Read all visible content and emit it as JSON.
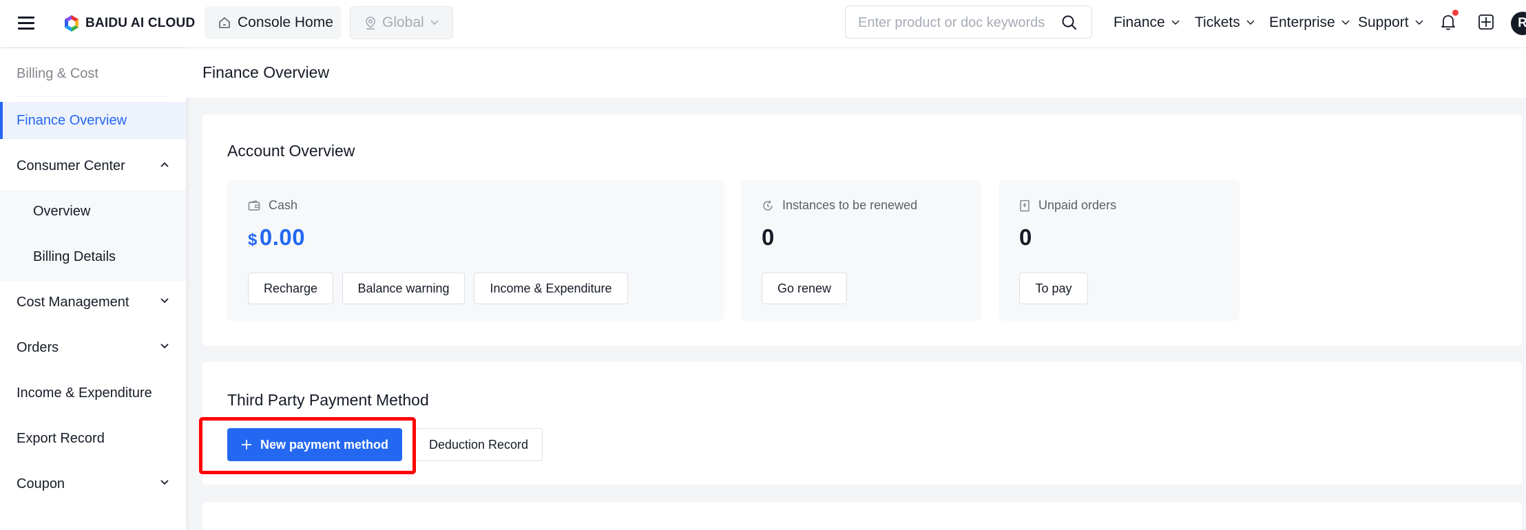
{
  "header": {
    "logo_text": "BAIDU AI CLOUD",
    "console_home": "Console Home",
    "region": "Global",
    "search_placeholder": "Enter product or doc keywords",
    "nav": [
      "Finance",
      "Tickets",
      "Enterprise",
      "Support"
    ],
    "avatar_letter": "R",
    "notification_dot_color": "#f33e3e"
  },
  "sidebar": {
    "title": "Billing & Cost",
    "items": [
      {
        "label": "Finance Overview",
        "active": true
      },
      {
        "label": "Consumer Center",
        "expanded": true
      },
      {
        "label": "Overview",
        "sub": true
      },
      {
        "label": "Billing Details",
        "sub": true
      },
      {
        "label": "Cost Management"
      },
      {
        "label": "Orders"
      },
      {
        "label": "Income & Expenditure"
      },
      {
        "label": "Export Record"
      },
      {
        "label": "Coupon"
      }
    ]
  },
  "main": {
    "page_title": "Finance Overview",
    "account_overview": {
      "title": "Account Overview",
      "cash": {
        "label": "Cash",
        "currency": "$",
        "value": "0.00",
        "buttons": [
          "Recharge",
          "Balance warning",
          "Income & Expenditure"
        ]
      },
      "renew": {
        "label": "Instances to be renewed",
        "value": "0",
        "button": "Go renew"
      },
      "unpaid": {
        "label": "Unpaid orders",
        "value": "0",
        "button": "To pay"
      }
    },
    "third_party": {
      "title": "Third Party Payment Method",
      "new_button": "New payment method",
      "deduction_button": "Deduction Record"
    }
  },
  "colors": {
    "accent": "#2468f2",
    "highlight": "#ff0000"
  }
}
